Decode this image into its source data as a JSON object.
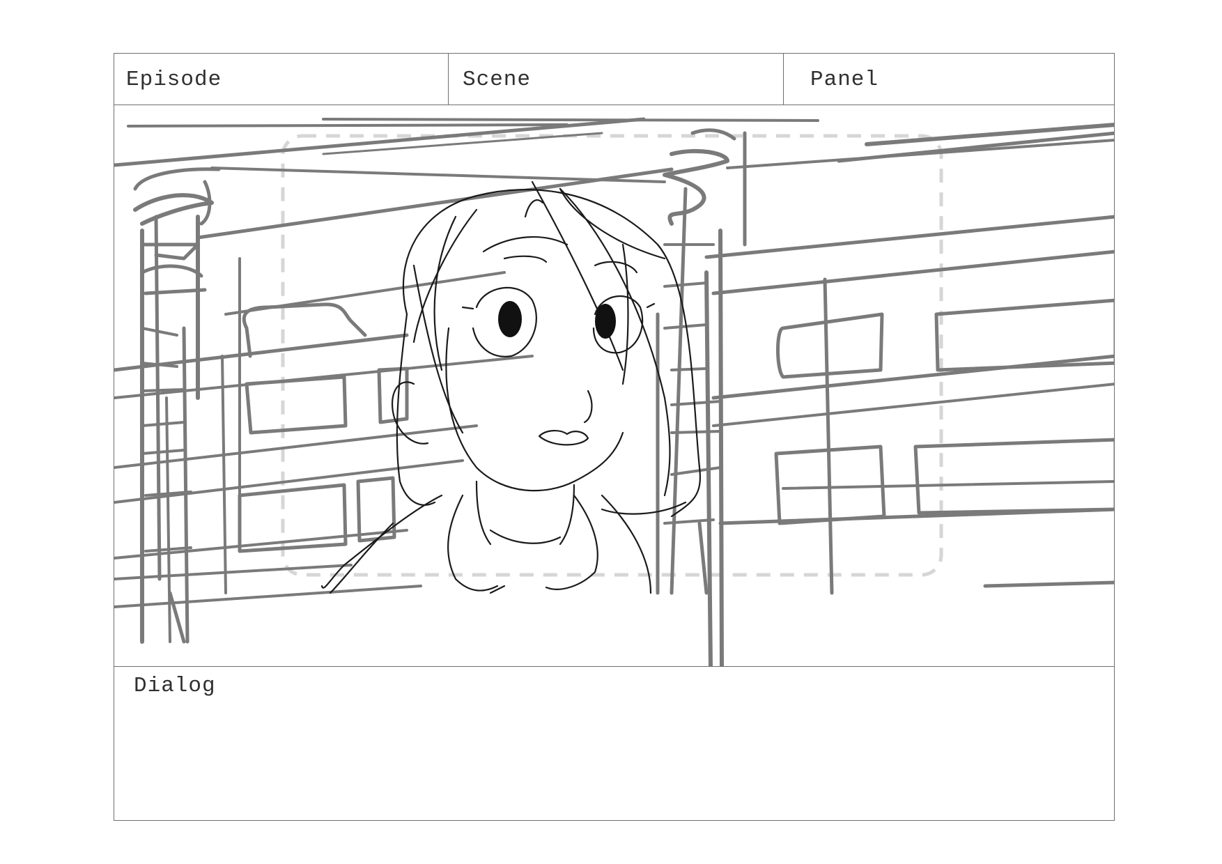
{
  "header": {
    "episode_label": "Episode",
    "scene_label": "Scene",
    "panel_label": "Panel"
  },
  "frame": {
    "subject": "storyboard-sketch",
    "colors": {
      "background_lines": "#7a7a7a",
      "character_lines": "#1a1a1a",
      "safe_area": "#d6d6d6"
    }
  },
  "dialog": {
    "label": "Dialog"
  }
}
